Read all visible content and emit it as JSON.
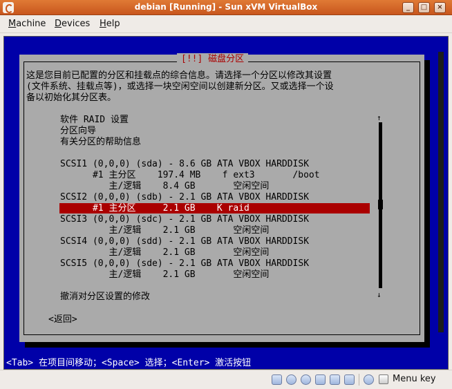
{
  "window": {
    "title": "debian [Running] - Sun xVM VirtualBox",
    "buttons": {
      "minimize": "_",
      "maximize": "□",
      "close": "×"
    }
  },
  "menubar": {
    "items": [
      {
        "key": "M",
        "rest": "achine"
      },
      {
        "key": "D",
        "rest": "evices"
      },
      {
        "key": "H",
        "rest": "elp"
      }
    ]
  },
  "installer": {
    "dialog_title": "[!!] 磁盘分区",
    "description": [
      "这是您目前已配置的分区和挂载点的综合信息。请选择一个分区以修改其设置",
      "(文件系统、挂载点等)，或选择一块空闲空间以创建新分区。又或选择一个设",
      "备以初始化其分区表。"
    ],
    "menu": [
      "软件 RAID 设置",
      "分区向导",
      "有关分区的帮助信息"
    ],
    "partitions": [
      "SCSI1 (0,0,0) (sda) - 8.6 GB ATA VBOX HARDDISK",
      "      #1 主分区    197.4 MB    f ext3       /boot",
      "         主/逻辑    8.4 GB       空闲空间",
      "SCSI2 (0,0,0) (sdb) - 2.1 GB ATA VBOX HARDDISK",
      "      #1 主分区     2.1 GB    K raid",
      "SCSI3 (0,0,0) (sdc) - 2.1 GB ATA VBOX HARDDISK",
      "         主/逻辑    2.1 GB       空闲空间",
      "SCSI4 (0,0,0) (sdd) - 2.1 GB ATA VBOX HARDDISK",
      "         主/逻辑    2.1 GB       空闲空间",
      "SCSI5 (0,0,0) (sde) - 2.1 GB ATA VBOX HARDDISK",
      "         主/逻辑    2.1 GB       空闲空间"
    ],
    "undo": "撤消对分区设置的修改",
    "back_button": "<返回>",
    "scroll_up": "↑",
    "scroll_down": "↓",
    "help_line": "<Tab> 在项目间移动；<Space> 选择；<Enter> 激活按钮"
  },
  "statusbar": {
    "host_key_label": "Menu key"
  }
}
